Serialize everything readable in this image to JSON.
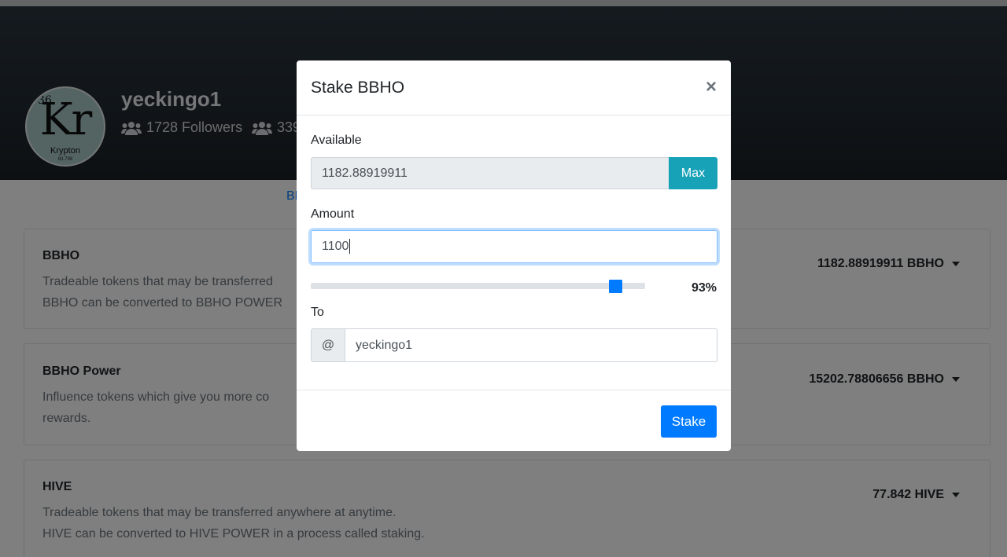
{
  "profile": {
    "username": "yeckingo1",
    "followers_text": "1728 Followers",
    "following_partial": "339",
    "avatar": {
      "symbol": "Kr",
      "number": "36",
      "name": "Krypton",
      "mass": "83.798"
    }
  },
  "tabs_peek": "BB",
  "cards": [
    {
      "title": "BBHO",
      "desc_line1": "Tradeable tokens that may be transferred",
      "desc_line2": "BBHO can be converted to BBHO POWER",
      "balance": "1182.88919911 BBHO"
    },
    {
      "title": "BBHO Power",
      "desc_line1": "Influence tokens which give you more co",
      "desc_line2": "rewards.",
      "balance": "15202.78806656 BBHO"
    },
    {
      "title": "HIVE",
      "desc_line1": "Tradeable tokens that may be transferred anywhere at anytime.",
      "desc_line2": "HIVE can be converted to HIVE POWER in a process called staking.",
      "balance": "77.842 HIVE"
    }
  ],
  "modal": {
    "title": "Stake BBHO",
    "close_glyph": "×",
    "available_label": "Available",
    "available_value": "1182.88919911",
    "max_label": "Max",
    "amount_label": "Amount",
    "amount_value": "1100",
    "slider_percent_value": 0.93,
    "slider_percent_text": "93%",
    "to_label": "To",
    "at_symbol": "@",
    "to_value": "yeckingo1",
    "stake_label": "Stake"
  },
  "colors": {
    "primary": "#007bff",
    "info": "#17a2b8",
    "header_bg": "#222b33"
  },
  "icons": [
    "users-icon",
    "close-icon",
    "caret-down-icon"
  ]
}
